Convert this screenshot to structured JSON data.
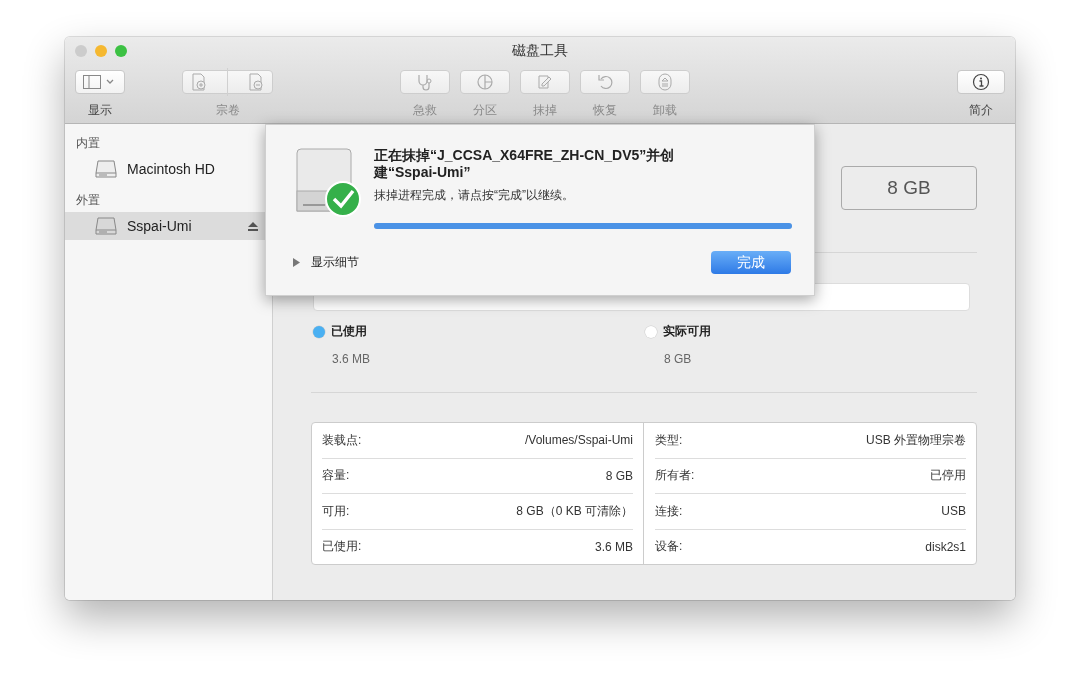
{
  "window": {
    "title": "磁盘工具"
  },
  "toolbar": [
    {
      "kind": "view",
      "label": "显示",
      "disabled": false
    },
    {
      "kind": "volume",
      "label": "宗卷",
      "disabled": true
    },
    {
      "kind": "firstaid",
      "label": "急救",
      "disabled": true
    },
    {
      "kind": "partition",
      "label": "分区",
      "disabled": true
    },
    {
      "kind": "erase",
      "label": "抹掉",
      "disabled": true
    },
    {
      "kind": "restore",
      "label": "恢复",
      "disabled": true
    },
    {
      "kind": "unmount",
      "label": "卸载",
      "disabled": true
    },
    {
      "kind": "info",
      "label": "简介",
      "disabled": false
    }
  ],
  "sidebar": {
    "sections": [
      {
        "header": "内置",
        "items": [
          {
            "name": "Macintosh HD",
            "selected": false,
            "ejectable": false
          }
        ]
      },
      {
        "header": "外置",
        "items": [
          {
            "name": "Sspai-Umi",
            "selected": true,
            "ejectable": true
          }
        ]
      }
    ]
  },
  "main": {
    "capacity": "8 GB",
    "legend": [
      {
        "label": "已使用",
        "value": "3.6 MB",
        "color": "#4ab0f2"
      },
      {
        "label": "实际可用",
        "value": "8 GB",
        "color": "#ffffff"
      }
    ],
    "info_left": [
      {
        "label": "装载点:",
        "value": "/Volumes/Sspai-Umi"
      },
      {
        "label": "容量:",
        "value": "8 GB"
      },
      {
        "label": "可用:",
        "value": "8 GB（0 KB 可清除）"
      },
      {
        "label": "已使用:",
        "value": "3.6 MB"
      }
    ],
    "info_right": [
      {
        "label": "类型:",
        "value": "USB 外置物理宗卷"
      },
      {
        "label": "所有者:",
        "value": "已停用"
      },
      {
        "label": "连接:",
        "value": "USB"
      },
      {
        "label": "设备:",
        "value": "disk2s1"
      }
    ]
  },
  "dialog": {
    "title": "正在抹掉“J_CCSA_X64FRE_ZH-CN_DV5”并创建“Sspai-Umi”",
    "message": "抹掉进程完成，请点按“完成”以继续。",
    "progress": {
      "level": 1
    },
    "details": {
      "label": "显示细节",
      "expanded": false
    },
    "button": "完成"
  }
}
